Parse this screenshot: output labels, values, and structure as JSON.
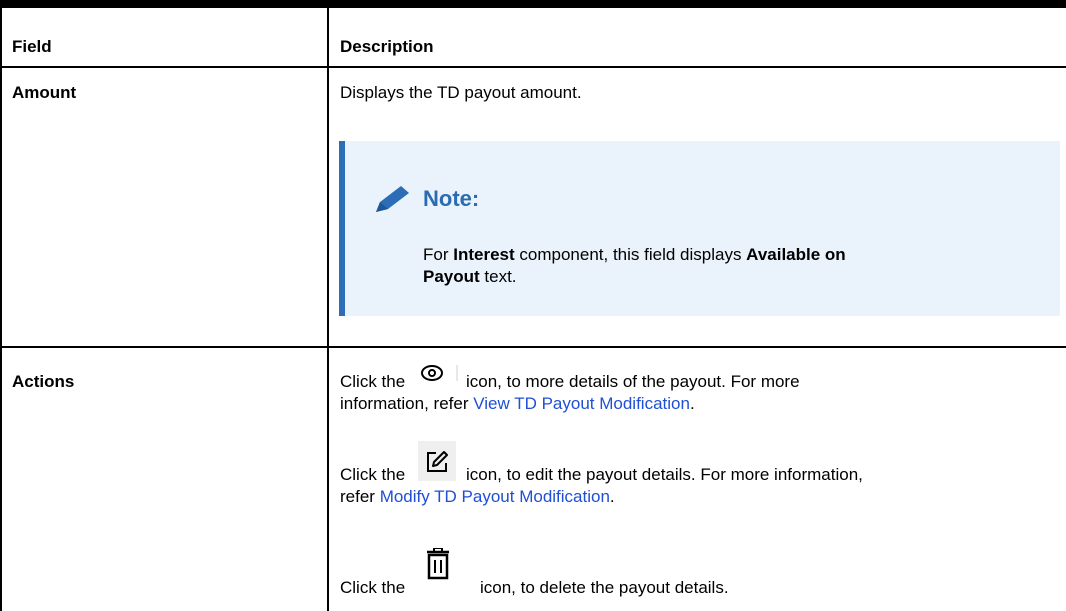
{
  "table": {
    "headers": {
      "field": "Field",
      "description": "Description"
    },
    "rows": {
      "amount": {
        "field": "Amount",
        "description": "Displays the TD payout amount.",
        "note": {
          "title": "Note:",
          "line1_pre": "For ",
          "line1_b1": "Interest",
          "line1_mid": " component, this field displays ",
          "line1_b2": "Available on",
          "line2_b": "Payout",
          "line2_post": " text."
        }
      },
      "actions": {
        "field": "Actions",
        "view": {
          "pre": "Click the",
          "post": "icon, to more details of the payout. For more",
          "line2_pre": "information, refer ",
          "link": "View TD Payout Modification",
          "line2_post": "."
        },
        "edit": {
          "pre": "Click the",
          "post": "icon, to edit the payout details. For more information,",
          "line2_pre": "refer ",
          "link": "Modify TD Payout Modification",
          "line2_post": "."
        },
        "delete": {
          "pre": "Click the",
          "post": "icon, to delete the payout details."
        }
      }
    }
  },
  "icons": {
    "note": "pencil-icon",
    "view": "eye-icon",
    "edit": "edit-icon",
    "delete": "trash-icon"
  },
  "colors": {
    "link": "#1f4fd6",
    "note_accent": "#2c6db5",
    "note_bg": "#eaf3fc",
    "note_title": "#2b6cb0"
  }
}
